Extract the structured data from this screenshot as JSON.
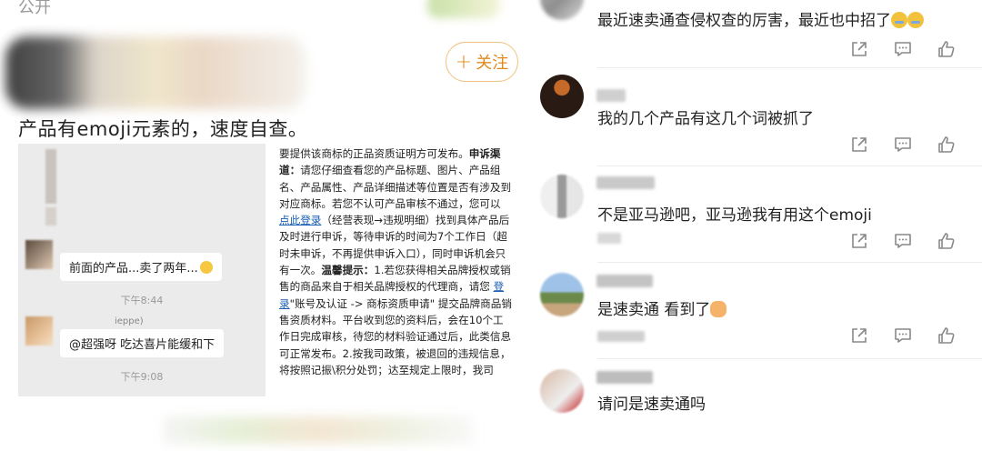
{
  "post": {
    "visibility": "公开",
    "follow_label": "关注",
    "follow_plus": "+",
    "text": "产品有emoji元素的，速度自查。"
  },
  "chat": {
    "msg1": "前面的产品...卖了两年...",
    "time1": "下午8:44",
    "msg2": "@超强呀 吃达喜片能缓和下",
    "time2": "下午9:08",
    "name_fragment": "ieppe)"
  },
  "doc": {
    "p1": "要提供该商标的正品资质证明方可发布。",
    "p1_bold": "申诉渠道：",
    "p2a": "请您仔细查看您的产品标题、图片、产品组名、产品属性、产品详细描述等位置是否有涉及到对应商标。若您不认可产品审核不通过，您可以 ",
    "link1": "点此登录",
    "p2b": "（经营表现→违规明细）找到具体产品后及时进行申诉，等待申诉的时间为7个工作日（超时未申诉，不再提供申诉入口），同时申诉机会只有一次。",
    "tip_bold": "温馨提示：",
    "p3a": "1.若您获得相关品牌授权或销售的商品来自于相关品牌授权的代理商，请您 ",
    "link2": "登录",
    "p3b": "\"账号及认证 -> 商标资质申请\" 提交品牌商品销售资质材料。平台收到您的资料后，会在10个工作日完成审核，待您的材料验证通过后，此类信息可正常发布。2.按我司政策，被退回的违规信息，将按照记振\\积分处罚；达至规定上限时，我司"
  },
  "comments": [
    {
      "text": "最近速卖通查侵权查的厉害，最近也中招了"
    },
    {
      "text": "我的几个产品有这几个词被抓了"
    },
    {
      "text": "不是亚马逊吧，亚马逊我有用这个emoji"
    },
    {
      "text": "是速卖通  看到了"
    },
    {
      "text": "请问是速卖通吗"
    }
  ],
  "icons": {
    "share": "share-icon",
    "comment": "comment-icon",
    "like": "like-icon"
  },
  "colors": {
    "follow_accent": "#e08a1e",
    "link": "#1a5fb4"
  }
}
